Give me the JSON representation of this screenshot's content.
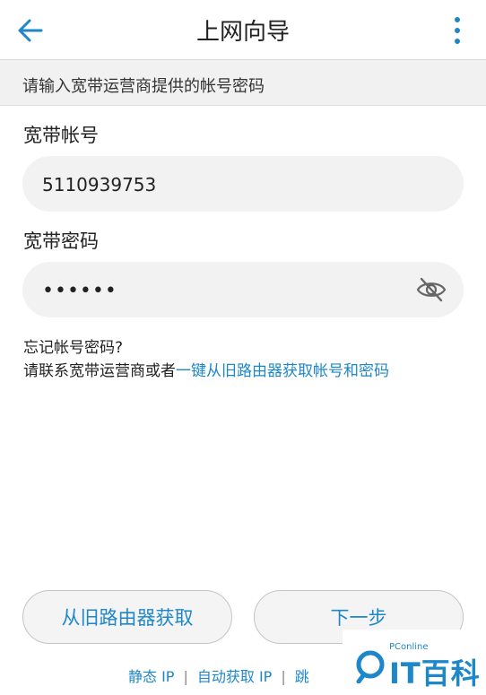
{
  "header": {
    "title": "上网向导",
    "back_icon": "arrow-left-icon",
    "more_icon": "more-vertical-icon"
  },
  "hint": "请输入宽带运营商提供的帐号密码",
  "account": {
    "label": "宽带帐号",
    "value": "5110939753"
  },
  "password": {
    "label": "宽带密码",
    "value": "••••••",
    "toggle_icon": "eye-off-icon"
  },
  "forgot": {
    "question": "忘记帐号密码?",
    "prefix": "请联系宽带运营商或者",
    "link": "一键从旧路由器获取帐号和密码"
  },
  "buttons": {
    "get_from_old": "从旧路由器获取",
    "next": "下一步"
  },
  "bottom_links": {
    "static_ip": "静态 IP",
    "sep": "|",
    "auto_ip": "自动获取 IP",
    "skip": "跳"
  },
  "watermark": {
    "small": "PConline",
    "text": "IT百科"
  },
  "colors": {
    "accent": "#1e87c9",
    "field_bg": "#f2f2f2",
    "hint_bg": "#f1f1f1"
  }
}
